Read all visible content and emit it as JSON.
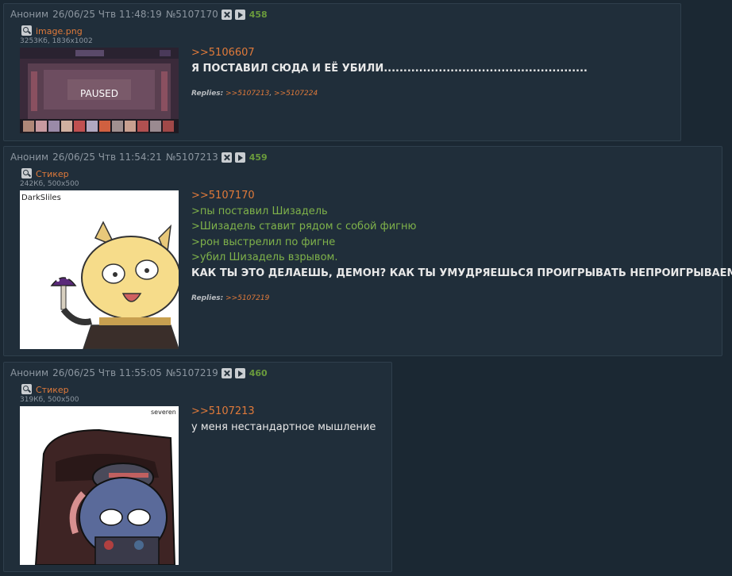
{
  "posts": [
    {
      "author": "Аноним",
      "datetime": "26/06/25 Чтв 11:48:19",
      "post_id": "№5107170",
      "number": "458",
      "file_name": "image.png",
      "file_meta": "3253Кб, 1836x1002",
      "thumb_text": "PAUSED",
      "lines": [
        "Я ПОСТАВИЛ СЮДА И ЕЁ УБИЛИ...................................................."
      ],
      "reply_link": ">>5106607",
      "replies_label": "Replies:",
      "replies": [
        ">>5107213",
        ">>5107224"
      ]
    },
    {
      "author": "Аноним",
      "datetime": "26/06/25 Чтв 11:54:21",
      "post_id": "№5107213",
      "number": "459",
      "file_name": "Стикер",
      "file_meta": "242Кб, 500x500",
      "thumb_text": "DarkSliles",
      "reply_link": ">>5107170",
      "quotes": [
        ">пы поставил Шизадель",
        ">Шизадель ставит рядом с собой фигню",
        ">рон выстрелил по фигне",
        ">убил Шизадель взрывом."
      ],
      "bold_line": "КАК ТЫ ЭТО ДЕЛАЕШЬ, ДЕМОН? КАК ТЫ УМУДРЯЕШЬСЯ ПРОИГРЫВАТЬ НЕПРОИГРЫВАЕМОЕ?!",
      "replies_label": "Replies:",
      "replies": [
        ">>5107219"
      ]
    },
    {
      "author": "Аноним",
      "datetime": "26/06/25 Чтв 11:55:05",
      "post_id": "№5107219",
      "number": "460",
      "file_name": "Стикер",
      "file_meta": "319Кб, 500x500",
      "thumb_text": "severen",
      "reply_link": ">>5107213",
      "plain_line": "у меня нестандартное мышление"
    }
  ],
  "colors": {
    "background": "#1b2833",
    "post": "#202e3a",
    "link": "#e07a3a",
    "quote": "#7fb24a",
    "number": "#6a9a3c"
  },
  "icons": [
    "hide-icon",
    "play-icon",
    "magnifier-icon"
  ]
}
